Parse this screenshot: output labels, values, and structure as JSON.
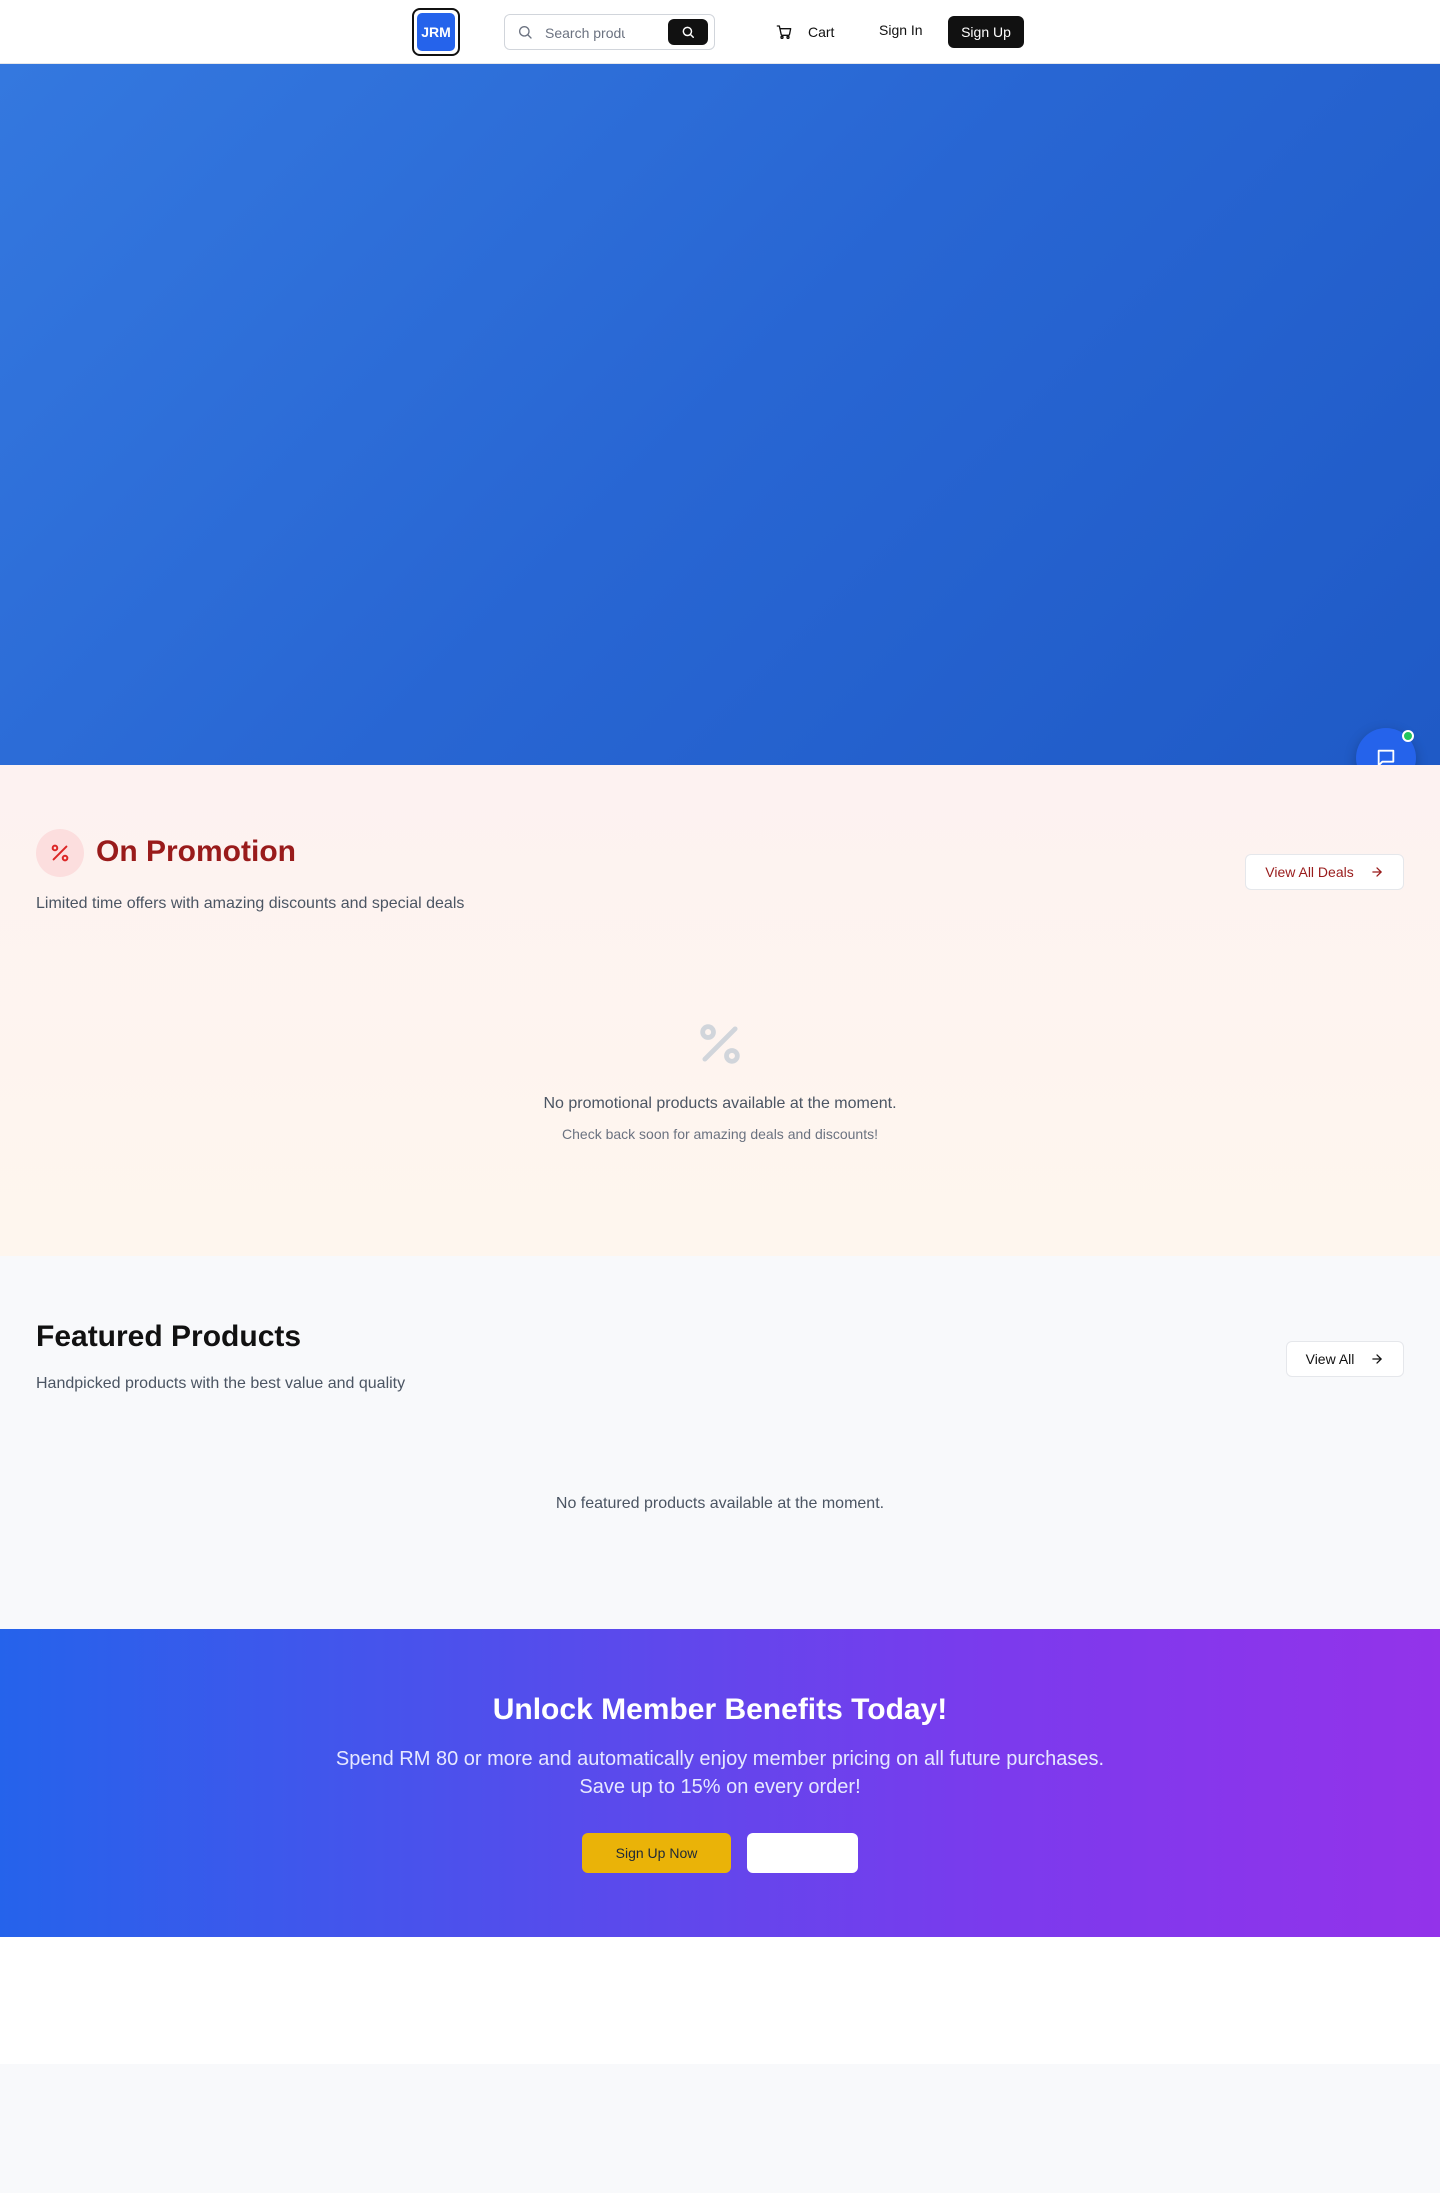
{
  "header": {
    "logo_text": "JRM",
    "search_placeholder": "Search products...",
    "cart_label": "Cart",
    "signin_label": "Sign In",
    "signup_label": "Sign Up"
  },
  "promotion": {
    "title": "On Promotion",
    "subtitle": "Limited time offers with amazing discounts and special deals",
    "view_all_label": "View All Deals",
    "empty_message": "No promotional products available at the moment.",
    "empty_hint": "Check back soon for amazing deals and discounts!"
  },
  "featured": {
    "title": "Featured Products",
    "subtitle": "Handpicked products with the best value and quality",
    "view_all_label": "View All",
    "empty_message": "No featured products available at the moment."
  },
  "member": {
    "title": "Unlock Member Benefits Today!",
    "line1": "Spend RM 80 or more and automatically enjoy member pricing on all future purchases.",
    "line2": "Save up to 15% on every order!",
    "signup_label": "Sign Up Now",
    "learn_label": ""
  },
  "colors": {
    "primary": "#2563eb",
    "promo_red": "#991b1b",
    "accent_yellow": "#eab308",
    "online_green": "#22c55e"
  },
  "icons": [
    "search-icon",
    "cart-icon",
    "percent-icon",
    "arrow-right-icon",
    "chat-icon"
  ]
}
